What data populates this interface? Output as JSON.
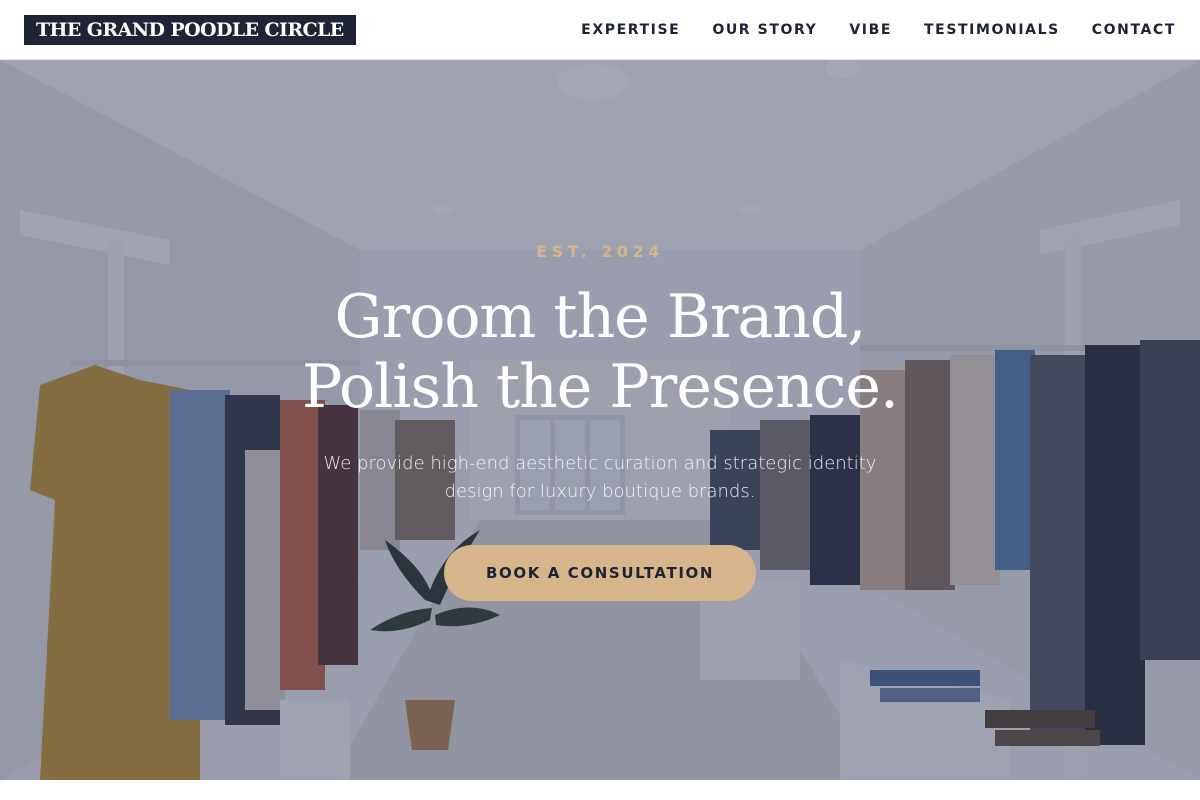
{
  "header": {
    "logo": "THE GRAND POODLE CIRCLE",
    "nav": [
      {
        "label": "EXPERTISE"
      },
      {
        "label": "OUR STORY"
      },
      {
        "label": "VIBE"
      },
      {
        "label": "TESTIMONIALS"
      },
      {
        "label": "CONTACT"
      }
    ]
  },
  "hero": {
    "eyebrow": "EST. 2024",
    "headline_line1": "Groom the Brand,",
    "headline_line2": "Polish the Presence.",
    "subtext": "We provide high-end aesthetic curation and strategic identity design for luxury boutique brands.",
    "cta_label": "BOOK A CONSULTATION",
    "background_image": "boutique-clothing-store-interior"
  },
  "colors": {
    "navy": "#1e2436",
    "gold": "#d6b58b",
    "white": "#ffffff"
  }
}
